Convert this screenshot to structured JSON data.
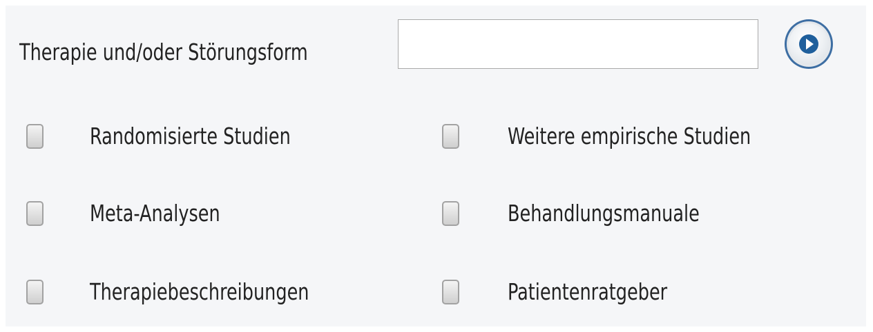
{
  "search": {
    "label": "Therapie und/oder Störungsform",
    "value": "",
    "placeholder": ""
  },
  "go_button": {
    "icon": "play-icon",
    "accent": "#1f5f9c"
  },
  "filters": [
    {
      "label": "Randomisierte Studien",
      "checked": false
    },
    {
      "label": "Weitere empirische Studien",
      "checked": false
    },
    {
      "label": "Meta-Analysen",
      "checked": false
    },
    {
      "label": "Behandlungsmanuale",
      "checked": false
    },
    {
      "label": "Therapiebeschreibungen",
      "checked": false
    },
    {
      "label": "Patientenratgeber",
      "checked": false
    }
  ]
}
